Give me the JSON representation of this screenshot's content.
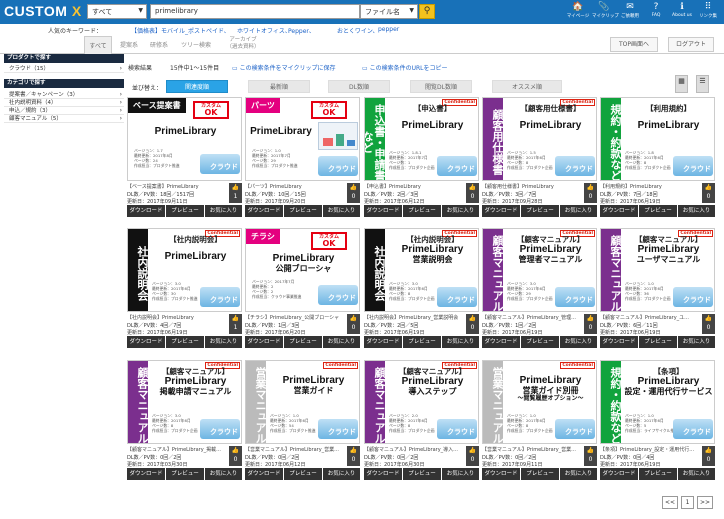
{
  "header": {
    "logo_main": "CUSTOM ",
    "logo_x": "X",
    "category_select": "すべて",
    "search_value": "primelibrary",
    "file_select": "ファイル名",
    "search_icon": "search-icon",
    "icons": [
      {
        "name": "mypage-icon",
        "glyph": "🏠",
        "label": "マイページ"
      },
      {
        "name": "myclip-icon",
        "glyph": "📎",
        "label": "マイクリップ"
      },
      {
        "name": "request-icon",
        "glyph": "✉",
        "label": "ご依頼用"
      },
      {
        "name": "faq-icon",
        "glyph": "?",
        "label": "FAQ"
      },
      {
        "name": "aboutus-icon",
        "glyph": "ℹ",
        "label": "About us"
      },
      {
        "name": "links-icon",
        "glyph": "⠿",
        "label": "リンク集"
      }
    ]
  },
  "keywords": {
    "label": "人気のキーワード：",
    "items": [
      "【価格表】モバイル_ポストペイド、",
      "ホワイトオフィス、",
      "Pepper、",
      "おとくワイン、",
      "pepper"
    ]
  },
  "tabs": [
    "すべて",
    "提案系",
    "研修系",
    "ツリー検索"
  ],
  "archive_tab": [
    "アーカイブ",
    "（過去資料）"
  ],
  "top_button": "TOP画面へ",
  "logout_button": "ログアウト",
  "sidebar": {
    "product_header": "プロダクトで探す",
    "products": [
      {
        "label": "クラウド（15）",
        "chev": "›"
      }
    ],
    "category_header": "カテゴリで探す",
    "categories": [
      {
        "label": "提案書／キャンペーン（3）",
        "chev": "›"
      },
      {
        "label": "社内説明資料（4）",
        "chev": "›"
      },
      {
        "label": "申込／規約（3）",
        "chev": "›"
      },
      {
        "label": "顧客マニュアル（5）",
        "chev": "›"
      }
    ]
  },
  "results": {
    "label": "検索結果",
    "count": "15件中1～15件目",
    "save_link": "この検索条件をマイクリップに保存",
    "url_link": "この検索条件のURLをコピー"
  },
  "sort": {
    "label": "並び替え：",
    "options": [
      "関連度順",
      "最新順",
      "DL数順",
      "閲覧DL数順",
      "オススメ順"
    ]
  },
  "view_icons": [
    "▦",
    "☰"
  ],
  "card_actions": [
    "ダウンロード",
    "プレビュー",
    "お気に入り"
  ],
  "cards": [
    {
      "banner": "ベース提案書",
      "banner_color": "#111111",
      "style": "ribbon",
      "title": "PrimeLibrary",
      "sub": "",
      "sub2": "",
      "stamp": true,
      "conf": false,
      "device": false,
      "meta": [
        "バージョン：1.7",
        "最終更新：2017年8月",
        "ページ数：24",
        "作成担当：プロダクト推進"
      ],
      "name": "【ベース提案書】PrimeLibrary",
      "stats": "DL数／PV数：18回／1517回",
      "date": "更新日：2017年09月11日",
      "count": "1"
    },
    {
      "banner": "パーツ",
      "banner_color": "#e4007f",
      "style": "ribbon",
      "title": "PrimeLibrary",
      "sub": "",
      "sub2": "",
      "stamp": true,
      "conf": false,
      "device": true,
      "meta": [
        "バージョン：1.0",
        "最終更新：2017年7月",
        "ページ数：29",
        "作成担当：プロダクト推進"
      ],
      "name": "【パーツ】PrimeLibrary",
      "stats": "DL数／PV数：10回／15回",
      "date": "更新日：2017年09月20日",
      "count": "0"
    },
    {
      "banner": "申込書・申請書など",
      "banner_color": "#11a33d",
      "style": "vert",
      "title": "PrimeLibrary",
      "sub": "",
      "sub2": "",
      "bracket": "【申込書】",
      "stamp": false,
      "conf": true,
      "device": false,
      "meta": [
        "バージョン：1.8.1",
        "最終更新：2017年7月",
        "ページ数：1",
        "作成担当：プロダクト企画"
      ],
      "name": "【申込書】PrimeLibrary",
      "stats": "DL数／PV数：2回／3回",
      "date": "更新日：2017年06月12日",
      "count": "0"
    },
    {
      "banner": "顧客用仕様書",
      "banner_color": "#7b2f8e",
      "style": "vert",
      "title": "PrimeLibrary",
      "sub": "",
      "sub2": "",
      "bracket": "【顧客用仕様書】",
      "stamp": false,
      "conf": true,
      "device": false,
      "meta": [
        "バージョン：1.5",
        "最終更新：2017年6月",
        "ページ数：8",
        "作成担当：プロダクト企画"
      ],
      "name": "【顧客用仕様書】PrimeLibrary",
      "stats": "DL数／PV数：3回／7回",
      "date": "更新日：2017年09月28日",
      "count": "0"
    },
    {
      "banner": "規約・約款など",
      "banner_color": "#11a33d",
      "style": "vert",
      "title": "PrimeLibrary",
      "sub": "",
      "sub2": "",
      "bracket": "【利用規約】",
      "stamp": false,
      "conf": false,
      "device": false,
      "meta": [
        "バージョン：1.8",
        "最終更新：2017年6月",
        "ページ数：8",
        "作成担当：プロダクト企画"
      ],
      "name": "【利用規約】PrimeLibrary",
      "stats": "DL数／PV数：7回／18回",
      "date": "更新日：2017年06月19日",
      "count": "0"
    },
    {
      "banner": "社内説明会",
      "banner_color": "#111111",
      "style": "vert",
      "title": "PrimeLibrary",
      "sub": "",
      "sub2": "",
      "bracket": "【社内説明会】",
      "stamp": false,
      "conf": true,
      "device": false,
      "meta": [
        "バージョン：3.0",
        "最終更新：2017年6月",
        "ページ数：30",
        "作成担当：プロダクト推進"
      ],
      "name": "【社内説明会】PrimeLibrary",
      "stats": "DL数／PV数：4回／7回",
      "date": "更新日：2017年06月19日",
      "count": "1"
    },
    {
      "banner": "チラシ",
      "banner_color": "#e4007f",
      "style": "ribbon",
      "title": "PrimeLibrary",
      "sub": "公開ブローシャ",
      "sub2": "",
      "stamp": true,
      "conf": false,
      "device": false,
      "meta": [
        "バージョン：2017年7月",
        "最終更新：2",
        "ページ数：2",
        "作成担当：クラウド事業推進"
      ],
      "name": "【チラシ】PrimeLibrary_公開ブローシャ",
      "stats": "DL数／PV数：1回／3回",
      "date": "更新日：2017年06月20日",
      "count": "0"
    },
    {
      "banner": "社内説明会",
      "banner_color": "#111111",
      "style": "vert",
      "title": "PrimeLibrary",
      "sub": "営業説明会",
      "sub2": "",
      "bracket": "【社内説明会】",
      "stamp": false,
      "conf": true,
      "device": false,
      "meta": [
        "バージョン：3.0",
        "最終更新：2017年6月",
        "ページ数：8",
        "作成担当：プロダクト企画"
      ],
      "name": "【社内説明会】PrimeLibrary_営業説明会",
      "stats": "DL数／PV数：2回／5回",
      "date": "更新日：2017年06月19日",
      "count": "0"
    },
    {
      "banner": "顧客マニュアル",
      "banner_color": "#7b2f8e",
      "style": "vert",
      "title": "PrimeLibrary",
      "sub": "管理者マニュアル",
      "sub2": "",
      "bracket": "【顧客マニュアル】",
      "stamp": false,
      "conf": true,
      "device": false,
      "meta": [
        "バージョン：3.0",
        "最終更新：2017年6月",
        "ページ数：29",
        "作成担当：プロダクト企画"
      ],
      "name": "【顧客マニュアル】PrimeLibrary_管理...",
      "stats": "DL数／PV数：1回／2回",
      "date": "更新日：2017年06月19日",
      "count": "0"
    },
    {
      "banner": "顧客マニュアル",
      "banner_color": "#7b2f8e",
      "style": "vert",
      "title": "PrimeLibrary",
      "sub": "ユーザマニュアル",
      "sub2": "",
      "bracket": "【顧客マニュアル】",
      "stamp": false,
      "conf": true,
      "device": false,
      "meta": [
        "バージョン：1.0",
        "最終更新：2017年6月",
        "ページ数：36",
        "作成担当：プロダクト企画"
      ],
      "name": "【顧客マニュアル】PrimeLibrary_ユ...",
      "stats": "DL数／PV数：6回／11回",
      "date": "更新日：2017年06月19日",
      "count": "0"
    },
    {
      "banner": "顧客マニュアル",
      "banner_color": "#7b2f8e",
      "style": "vert",
      "title": "PrimeLibrary",
      "sub": "掲載申請マニュアル",
      "sub2": "",
      "bracket": "【顧客マニュアル】",
      "stamp": false,
      "conf": true,
      "device": false,
      "meta": [
        "バージョン：3.0",
        "最終更新：2017年6月",
        "ページ数：8",
        "作成担当：プロダクト企画"
      ],
      "name": "【顧客マニュアル】PrimeLibrary_掲載...",
      "stats": "DL数／PV数：0回／2回",
      "date": "更新日：2017年03月30日",
      "count": "0"
    },
    {
      "banner": "営業マニュアル",
      "banner_color": "#bbbbbb",
      "style": "vert",
      "title": "PrimeLibrary",
      "sub": "営業ガイド",
      "sub2": "",
      "stamp": false,
      "conf": true,
      "device": false,
      "meta": [
        "バージョン：1.0",
        "最終更新：2017年6月",
        "ページ数：54",
        "作成担当：プロダクト推進"
      ],
      "name": "【営業マニュアル】PrimeLibrary_営業...",
      "stats": "DL数／PV数：0回／2回",
      "date": "更新日：2017年06月12日",
      "count": "0"
    },
    {
      "banner": "顧客マニュアル",
      "banner_color": "#7b2f8e",
      "style": "vert",
      "title": "PrimeLibrary",
      "sub": "導入ステップ",
      "sub2": "",
      "bracket": "【顧客マニュアル】",
      "stamp": false,
      "conf": true,
      "device": false,
      "meta": [
        "バージョン：2.0",
        "最終更新：2017年6月",
        "ページ数：8",
        "作成担当：プロダクト企画"
      ],
      "name": "【顧客マニュアル】PrimeLibrary_導入...",
      "stats": "DL数／PV数：0回／2回",
      "date": "更新日：2017年06月30日",
      "count": "0"
    },
    {
      "banner": "営業マニュアル",
      "banner_color": "#bbbbbb",
      "style": "vert",
      "title": "PrimeLibrary",
      "sub": "営業ガイド別冊",
      "sub2": "～閲覧履歴オプション～",
      "stamp": false,
      "conf": true,
      "device": false,
      "meta": [
        "バージョン：1.0",
        "最終更新：2017年6月",
        "ページ数：8",
        "作成担当：プロダクト企画"
      ],
      "name": "【営業マニュアル】PrimeLibrary_営業...",
      "stats": "DL数／PV数：0回／2回",
      "date": "更新日：2017年09月11日",
      "count": "0"
    },
    {
      "banner": "規約・約款など",
      "banner_color": "#11a33d",
      "style": "vert",
      "title": "PrimeLibrary",
      "sub": "設定・運用代行サービス",
      "sub2": "",
      "bracket": "【条項】",
      "stamp": false,
      "conf": false,
      "device": false,
      "meta": [
        "バージョン：1.0",
        "最終更新：2017年6月",
        "ページ数：5",
        "作成担当：ライフサイクル推進"
      ],
      "name": "【条項】PrimeLibrary_設定・運用代行...",
      "stats": "DL数／PV数：0回／4回",
      "date": "更新日：2017年06月19日",
      "count": "0"
    }
  ],
  "pagination": [
    "<<",
    "1",
    ">>"
  ]
}
